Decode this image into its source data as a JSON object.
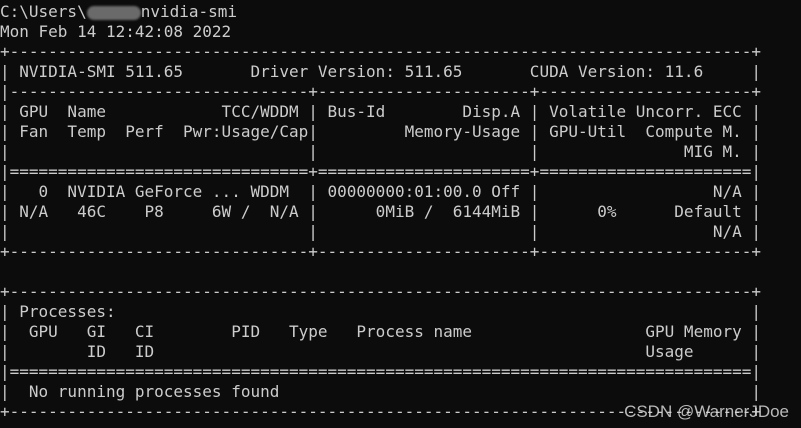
{
  "terminal": {
    "prompt_prefix": "C:\\Users\\",
    "command": "nvidia-smi",
    "timestamp": "Mon Feb 14 12:42:08 2022",
    "lines": [
      "+-----------------------------------------------------------------------------+",
      "| NVIDIA-SMI 511.65       Driver Version: 511.65       CUDA Version: 11.6     |",
      "|-------------------------------+----------------------+----------------------+",
      "| GPU  Name            TCC/WDDM | Bus-Id        Disp.A | Volatile Uncorr. ECC |",
      "| Fan  Temp  Perf  Pwr:Usage/Cap|         Memory-Usage | GPU-Util  Compute M. |",
      "|                               |                      |               MIG M. |",
      "|===============================+======================+======================|",
      "|   0  NVIDIA GeForce ... WDDM  | 00000000:01:00.0 Off |                  N/A |",
      "| N/A   46C    P8     6W /  N/A |      0MiB /  6144MiB |      0%      Default |",
      "|                               |                      |                  N/A |",
      "+-------------------------------+----------------------+----------------------+",
      "",
      "+-----------------------------------------------------------------------------+",
      "| Processes:                                                                  |",
      "|  GPU   GI   CI        PID   Type   Process name                  GPU Memory |",
      "|        ID   ID                                                   Usage      |",
      "|=============================================================================|",
      "|  No running processes found                                                 |",
      "+-----------------------------------------------------------------------------+"
    ]
  },
  "watermark": "CSDN @WarnerJDoe"
}
